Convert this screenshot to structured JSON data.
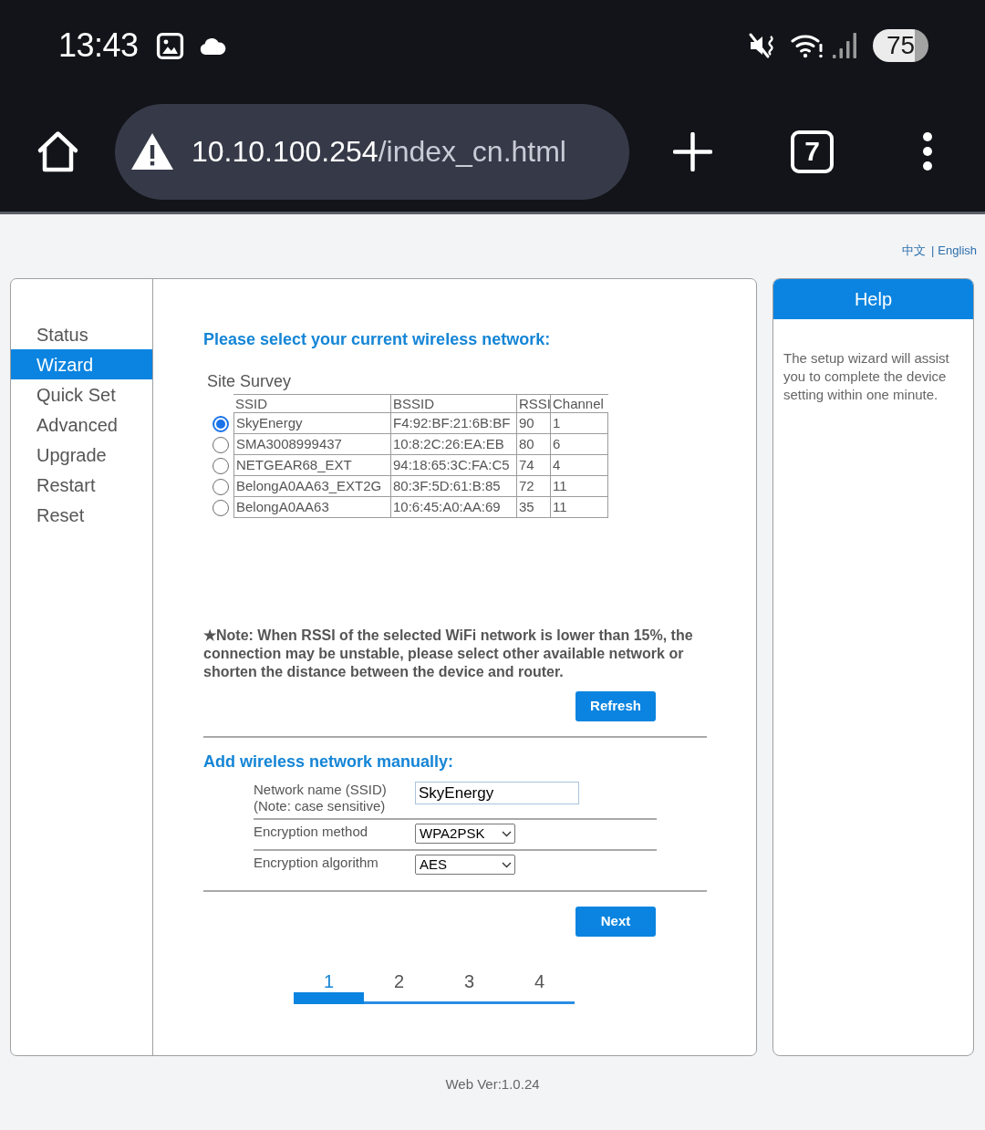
{
  "status_bar": {
    "time": "13:43",
    "battery": "75"
  },
  "browser": {
    "url": {
      "host": "10.10.100.254",
      "path": "/index_cn.html"
    },
    "tab_count": "7"
  },
  "language_links": {
    "items": [
      "中文",
      "English"
    ],
    "separator": "|"
  },
  "sidebar": {
    "items": [
      {
        "label": "Status",
        "selected": false
      },
      {
        "label": "Wizard",
        "selected": true
      },
      {
        "label": "Quick Set",
        "selected": false
      },
      {
        "label": "Advanced",
        "selected": false
      },
      {
        "label": "Upgrade",
        "selected": false
      },
      {
        "label": "Restart",
        "selected": false
      },
      {
        "label": "Reset",
        "selected": false
      }
    ]
  },
  "wizard": {
    "title": "Please select your current wireless network:",
    "site_survey": {
      "title": "Site Survey",
      "columns": [
        "SSID",
        "BSSID",
        "RSSI",
        "Channel"
      ],
      "rows": [
        {
          "ssid": "SkyEnergy",
          "bssid": "F4:92:BF:21:6B:BF",
          "rssi": "90",
          "channel": "1",
          "selected": true
        },
        {
          "ssid": "SMA3008999437",
          "bssid": "10:8:2C:26:EA:EB",
          "rssi": "80",
          "channel": "6",
          "selected": false
        },
        {
          "ssid": "NETGEAR68_EXT",
          "bssid": "94:18:65:3C:FA:C5",
          "rssi": "74",
          "channel": "4",
          "selected": false
        },
        {
          "ssid": "BelongA0AA63_EXT2G",
          "bssid": "80:3F:5D:61:B:85",
          "rssi": "72",
          "channel": "11",
          "selected": false
        },
        {
          "ssid": "BelongA0AA63",
          "bssid": "10:6:45:A0:AA:69",
          "rssi": "35",
          "channel": "11",
          "selected": false
        }
      ]
    },
    "note": "★Note: When RSSI of the selected WiFi network is lower than 15%, the connection may be unstable, please select other available network or shorten the distance between the device and router.",
    "refresh_button": "Refresh",
    "manual": {
      "title": "Add wireless network manually:",
      "fields": [
        {
          "kind": "text",
          "label": "Network name (SSID)",
          "note": "(Note: case sensitive)",
          "value": "SkyEnergy"
        },
        {
          "kind": "select",
          "label": "Encryption method",
          "value": "WPA2PSK"
        },
        {
          "kind": "select",
          "label": "Encryption algorithm",
          "value": "AES"
        }
      ]
    },
    "next_button": "Next",
    "steps": [
      {
        "label": "1",
        "selected": true
      },
      {
        "label": "2",
        "selected": false
      },
      {
        "label": "3",
        "selected": false
      },
      {
        "label": "4",
        "selected": false
      }
    ]
  },
  "help": {
    "title": "Help",
    "text": "The setup wizard will assist you to complete the device setting within one minute."
  },
  "footer": "Web Ver:1.0.24"
}
